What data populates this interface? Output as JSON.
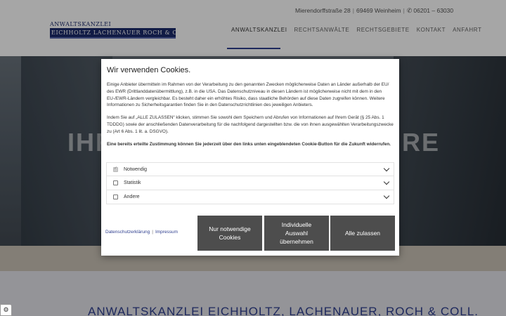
{
  "header": {
    "address": "Mierendorffstraße 28",
    "city": "69469 Weinheim",
    "phone": "06201 – 63030",
    "logo_top": "ANWALTSKANZLEI",
    "logo_bottom": "EICHHOLTZ LACHENAUER ROCH & COLL.",
    "nav": [
      {
        "label": "ANWALTSKANZLEI",
        "active": true
      },
      {
        "label": "RECHTSANWÄLTE",
        "active": false
      },
      {
        "label": "RECHTSGEBIETE",
        "active": false
      },
      {
        "label": "KONTAKT",
        "active": false
      },
      {
        "label": "ANFAHRT",
        "active": false
      }
    ]
  },
  "hero": {
    "title_left": "IHR",
    "title_right": "RE"
  },
  "bottom": {
    "title": "ANWALTSKANZLEI EICHHOLTZ, LACHENAUER, ROCH & COLL."
  },
  "cookie": {
    "title": "Wir verwenden Cookies.",
    "paragraph1": "Einige Anbieter übermitteln im Rahmen von der Verarbeitung zu den genannten Zwecken möglicherweise Daten an Länder außerhalb der EU/ des EWR (Drittlanddatenübermittlung), z.B. in die USA. Das Datenschutzniveau in diesen Ländern ist möglicherweise nicht mit dem in den EU-/EWR-Ländern vergleichbar. Es besteht daher ein erhöhtes Risiko, dass staatliche Behörden auf diese Daten zugreifen können. Weitere Informationen zu Sicherheitsgarantien finden Sie in den Datenschutzrichtlinien des jeweiligen Anbieters.",
    "paragraph2": "Indem Sie auf „ALLE ZULASSEN“ klicken, stimmen Sie sowohl dem Speichern und Abrufen von Informationen auf Ihrem Gerät (§ 25 Abs. 1 TDDDG) sowie der anschließenden Datenverarbeitung für die nachfolgend dargestellten bzw. die von ihnen ausgewählten Verarbeitungszwecke zu (Art 6 Abs. 1 lit. a. DSGVO).",
    "paragraph3": "Eine bereits erteilte Zustimmung können Sie jederzeit über den links unten eingeblendeten Cookie-Button für die Zukunft widerrufen.",
    "options": [
      {
        "label": "Notwendig",
        "checked": true
      },
      {
        "label": "Statistik",
        "checked": false
      },
      {
        "label": "Andere",
        "checked": false
      }
    ],
    "privacy_link": "Datenschutzerklärung",
    "imprint_link": "Impressum",
    "btn_necessary": "Nur notwendige Cookies",
    "btn_individual": "Individuelle Auswahl übernehmen",
    "btn_all": "Alle zulassen"
  },
  "icons": {
    "phone": "phone-icon",
    "cookie_settings": "cookie-settings-icon",
    "chevron": "chevron-down-icon"
  }
}
